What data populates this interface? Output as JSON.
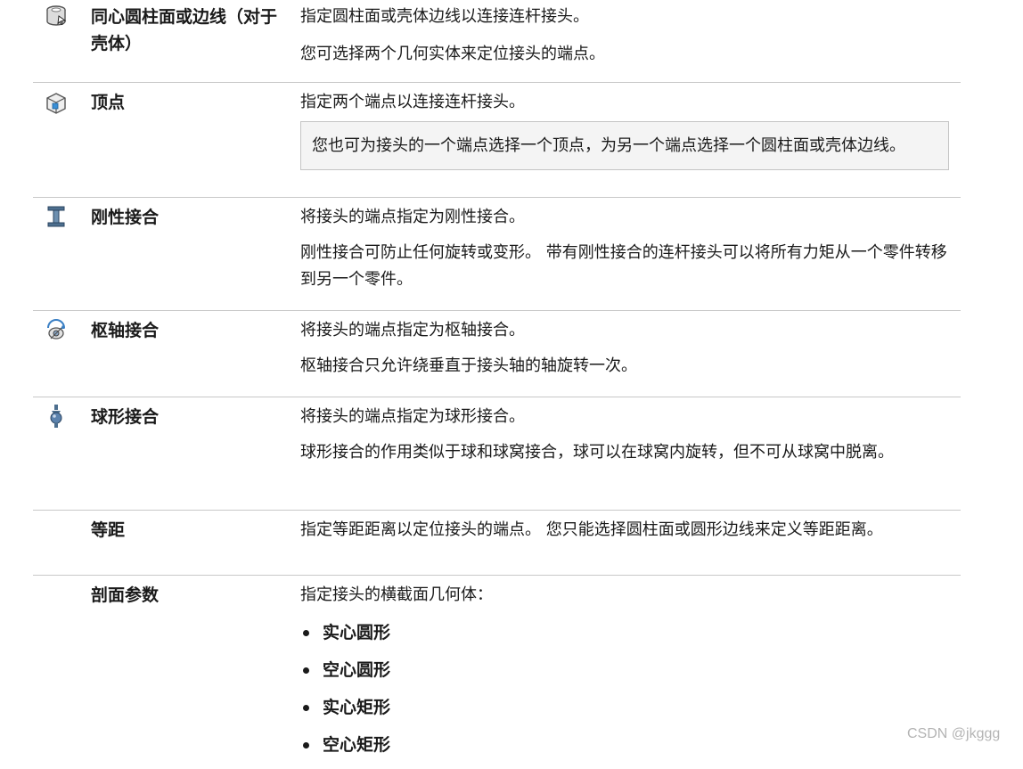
{
  "rows": [
    {
      "icon": "concentric-cylinder-icon",
      "term": "同心圆柱面或边线（对于壳体）",
      "paragraphs": [
        "指定圆柱面或壳体边线以连接连杆接头。",
        "您可选择两个几何实体来定位接头的端点。"
      ]
    },
    {
      "icon": "vertex-cube-icon",
      "term": "顶点",
      "paragraphs": [
        "指定两个端点以连接连杆接头。"
      ],
      "note": "您也可为接头的一个端点选择一个顶点，为另一个端点选择一个圆柱面或壳体边线。"
    },
    {
      "icon": "rigid-joint-icon",
      "term": "刚性接合",
      "paragraphs": [
        "将接头的端点指定为刚性接合。",
        "刚性接合可防止任何旋转或变形。 带有刚性接合的连杆接头可以将所有力矩从一个零件转移到另一个零件。"
      ]
    },
    {
      "icon": "pivot-joint-icon",
      "term": "枢轴接合",
      "paragraphs": [
        "将接头的端点指定为枢轴接合。",
        "枢轴接合只允许绕垂直于接头轴的轴旋转一次。"
      ]
    },
    {
      "icon": "ball-joint-icon",
      "term": "球形接合",
      "paragraphs": [
        "将接头的端点指定为球形接合。",
        "球形接合的作用类似于球和球窝接合，球可以在球窝内旋转，但不可从球窝中脱离。"
      ]
    },
    {
      "term": "等距",
      "paragraphs": [
        "指定等距距离以定位接头的端点。 您只能选择圆柱面或圆形边线来定义等距距离。"
      ]
    },
    {
      "term": "剖面参数",
      "paragraphs": [
        "指定接头的横截面几何体："
      ],
      "bullets": [
        "实心圆形",
        "空心圆形",
        "实心矩形",
        "空心矩形"
      ]
    }
  ],
  "watermark": "CSDN @jkggg"
}
